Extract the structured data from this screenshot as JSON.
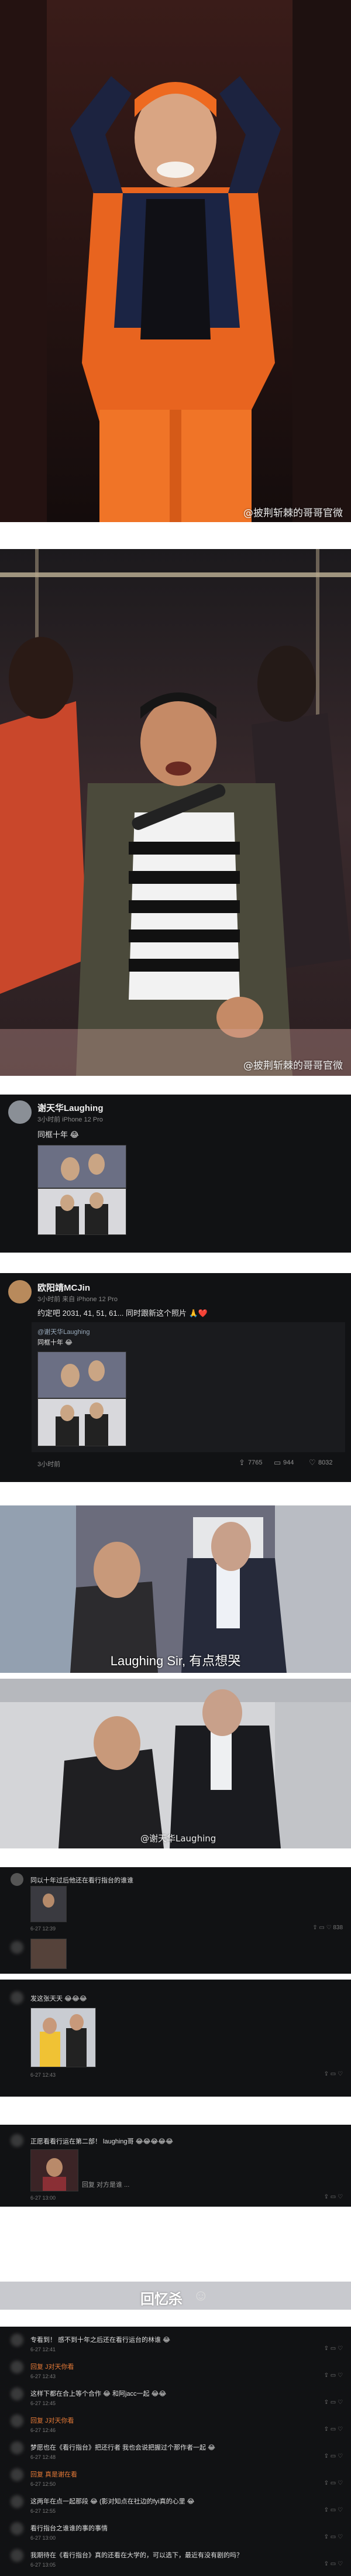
{
  "photo1": {
    "watermark": "@披荆斩棘的哥哥官微"
  },
  "photo2": {
    "watermark": "@披荆斩棘的哥哥官微"
  },
  "post1": {
    "username": "谢天华Laughing",
    "meta": "3小时前 iPhone 12 Pro",
    "text": "同框十年 😂"
  },
  "post2": {
    "username": "欧阳靖MCJin",
    "meta": "3小时前 来自 iPhone 12 Pro",
    "text": "约定吧 2031, 41, 51, 61... 同时跟新这个照片 🙏❤️",
    "quoted_user": "@谢天华Laughing",
    "quoted_text": "同框十年 😂",
    "stats": {
      "shares": "7765",
      "comments": "944",
      "likes": "8032"
    },
    "time_label": "3小时前"
  },
  "photo3": {
    "subtitle": "Laughing Sir, 有点想哭"
  },
  "photo4": {
    "watermark": "@谢天华Laughing"
  },
  "comments1": [
    {
      "text": "同以十年过后他还在看行指台的谁谁",
      "time": "6-27 12:39"
    },
    {
      "text": "",
      "time": "6-27 12:39"
    }
  ],
  "comments2": [
    {
      "text": "发这张天天 😂😂😂",
      "time": "6-27 12:43"
    }
  ],
  "comments3": [
    {
      "text": "正愿看看行运在第二部！ laughing哥 😂😂😂😂😂",
      "time": "6-27 13:00"
    },
    {
      "text": "回复 对方是谁 ...",
      "time": ""
    }
  ],
  "banner": {
    "text": "回忆杀"
  },
  "comments4": [
    {
      "text": "专看到！ 感不到十年之后还在看行运台的林谁 😂",
      "time": "6-27 12:41"
    },
    {
      "text": "回复 J对天你看",
      "time": "6-27 12:43"
    },
    {
      "text": "这样下都在合上等个合作 😂 和阿jacc一起 😂😂",
      "time": "6-27 12:45"
    },
    {
      "text": "回复 J对天你看",
      "time": "6-27 12:46"
    },
    {
      "text": "梦愿也在《看行指台》把还行者 我也会说把握过个那作者一起 😂",
      "time": "6-27 12:48"
    },
    {
      "text": "回复 真是谢在看",
      "time": "6-27 12:50"
    },
    {
      "text": "这两年在点一起那段 😂 (影对知点在社边的fyi真的心里 😂",
      "time": "6-27 12:55"
    },
    {
      "text": "看行指台之谁谁的事的事情",
      "time": "6-27 13:00"
    },
    {
      "text": "我期待在《看行指台》真的还看在大学的，可以选下，最近有没有剧的吗？",
      "time": "6-27 13:05"
    }
  ]
}
